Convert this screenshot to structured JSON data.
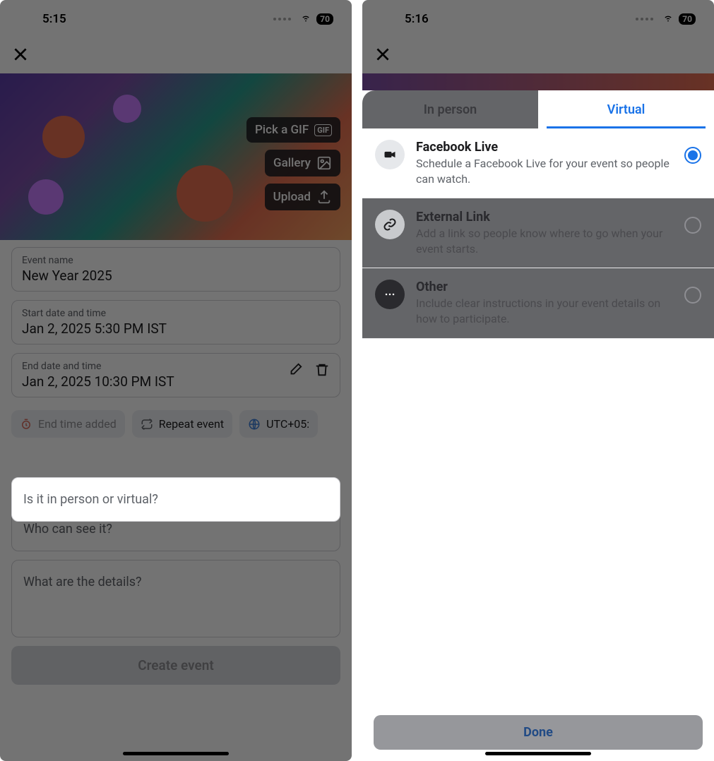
{
  "left": {
    "status": {
      "time": "5:15",
      "battery": "70"
    },
    "cover": {
      "pick_gif": "Pick a GIF",
      "gif_badge": "GIF",
      "gallery": "Gallery",
      "upload": "Upload"
    },
    "fields": {
      "name_label": "Event name",
      "name_value": "New Year 2025",
      "start_label": "Start date and time",
      "start_value": "Jan 2, 2025 5:30 PM IST",
      "end_label": "End date and time",
      "end_value": "Jan 2, 2025 10:30 PM IST"
    },
    "chips": {
      "end_added": "End time added",
      "repeat": "Repeat event",
      "tz": "UTC+05:"
    },
    "prompts": {
      "location": "Is it in person or virtual?",
      "visibility": "Who can see it?",
      "details": "What are the details?"
    },
    "create_label": "Create event"
  },
  "right": {
    "status": {
      "time": "5:16",
      "battery": "70"
    },
    "tabs": {
      "in_person": "In person",
      "virtual": "Virtual"
    },
    "options": [
      {
        "title": "Facebook Live",
        "desc": "Schedule a Facebook Live for your event so people can watch."
      },
      {
        "title": "External Link",
        "desc": "Add a link so people know where to go when your event starts."
      },
      {
        "title": "Other",
        "desc": "Include clear instructions in your event details on how to participate."
      }
    ],
    "done_label": "Done"
  }
}
